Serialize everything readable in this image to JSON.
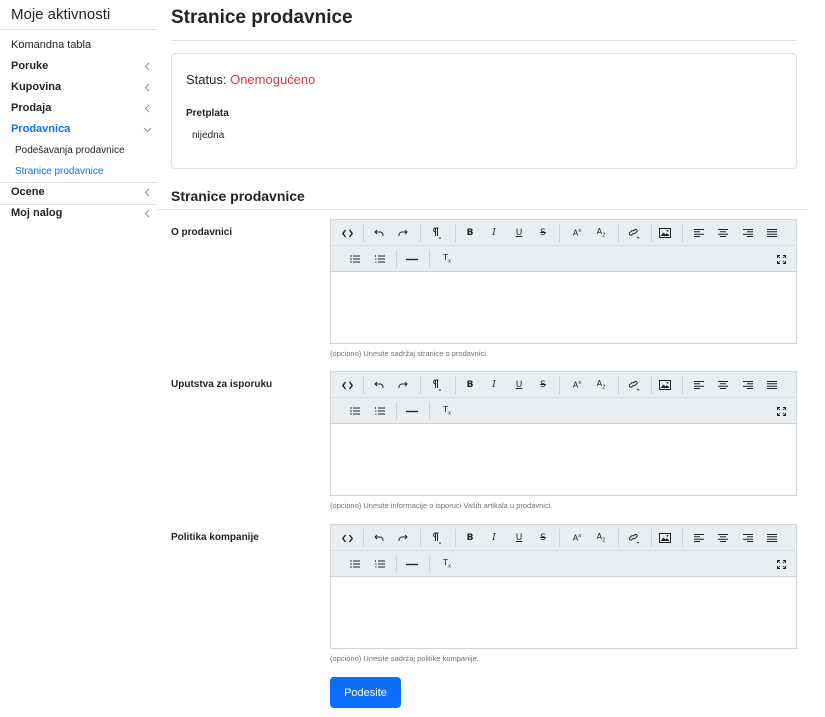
{
  "sidebar": {
    "title": "Moje aktivnosti",
    "items": [
      {
        "label": "Komandna tabla"
      },
      {
        "label": "Poruke"
      },
      {
        "label": "Kupovina"
      },
      {
        "label": "Prodaja"
      },
      {
        "label": "Prodavnica"
      },
      {
        "label": "Podešavanja prodavnice"
      },
      {
        "label": "Stranice prodavnice"
      },
      {
        "label": "Ocene"
      },
      {
        "label": "Moj nalog"
      }
    ]
  },
  "page": {
    "title": "Stranice prodavnice"
  },
  "status_card": {
    "status_label": "Status:",
    "status_value": "Onemogućeno",
    "status_color": "#dc3545",
    "subscription_label": "Pretplata",
    "subscription_value": "nijedna"
  },
  "section": {
    "title": "Stranice prodavnice"
  },
  "editors": [
    {
      "label": "O prodavnici",
      "help": "(opciono) Unesite sadržaj stranice o prodavnici."
    },
    {
      "label": "Uputstva za isporuku",
      "help": "(opciono) Unesite informacije o isporuci Vaših artikala u prodavnici."
    },
    {
      "label": "Politika kompanije",
      "help": "(opciono) Unesite sadržaj politike kompanije."
    }
  ],
  "toolbar_icons": [
    "code-view-icon",
    "undo-icon",
    "redo-icon",
    "paragraph-format-icon",
    "bold-icon",
    "italic-icon",
    "underline-icon",
    "strikethrough-icon",
    "superscript-icon",
    "subscript-icon",
    "link-icon",
    "image-icon",
    "align-left-icon",
    "align-center-icon",
    "align-right-icon",
    "align-justify-icon",
    "bullet-list-icon",
    "numbered-list-icon",
    "horizontal-line-icon",
    "clear-format-icon",
    "fullscreen-icon"
  ],
  "submit": {
    "label": "Podesite"
  },
  "colors": {
    "accent": "#0d6efd",
    "danger": "#dc3545",
    "toolbar_bg": "#ebeef0"
  }
}
